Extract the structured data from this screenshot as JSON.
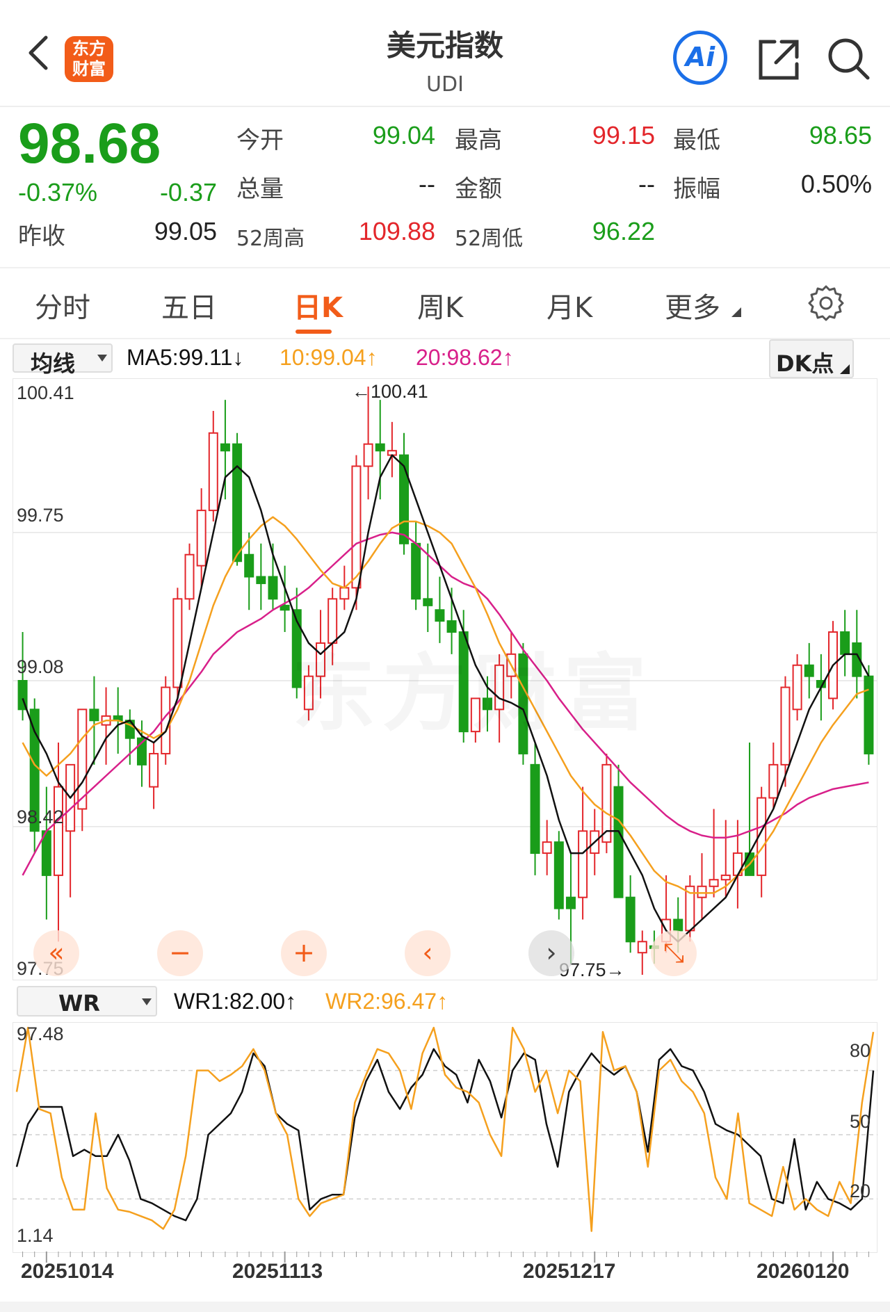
{
  "header": {
    "title": "美元指数",
    "subtitle": "UDI",
    "logo_line1": "东方",
    "logo_line2": "财富",
    "ai_label": "Ai"
  },
  "quote": {
    "price": "98.68",
    "change_pct": "-0.37%",
    "change": "-0.37",
    "prev_close_label": "昨收",
    "prev_close": "99.05",
    "open_label": "今开",
    "open": "99.04",
    "high_label": "最高",
    "high": "99.15",
    "low_label": "最低",
    "low": "98.65",
    "volume_label": "总量",
    "volume": "--",
    "amount_label": "金额",
    "amount": "--",
    "amplitude_label": "振幅",
    "amplitude": "0.50%",
    "w52_high_label": "52周高",
    "w52_high": "109.88",
    "w52_low_label": "52周低",
    "w52_low": "96.22"
  },
  "tabs": [
    {
      "label": "分时"
    },
    {
      "label": "五日"
    },
    {
      "label": "日K"
    },
    {
      "label": "周K"
    },
    {
      "label": "月K"
    },
    {
      "label": "更多"
    }
  ],
  "main_chart": {
    "indicator_select": "均线",
    "ma5": "MA5:99.11↓",
    "ma10": "10:99.04↑",
    "ma20": "20:98.62↑",
    "dk_button": "DK点",
    "y_labels": [
      "100.41",
      "99.75",
      "99.08",
      "98.42",
      "97.75"
    ],
    "max_marker": "←100.41",
    "min_marker": "97.75→",
    "watermark": "东方财富"
  },
  "sub_chart": {
    "indicator_select": "WR",
    "wr1": "WR1:82.00↑",
    "wr2": "WR2:96.47↑",
    "y_max": "97.48",
    "y_min": "1.14",
    "levels": [
      "80",
      "50",
      "20"
    ]
  },
  "dates": [
    "20251014",
    "20251113",
    "20251217",
    "20260120"
  ],
  "colors": {
    "up": "#e3262b",
    "down": "#1a9d1a",
    "ma5": "#111111",
    "ma10": "#f5a01e",
    "ma20": "#d8208a",
    "accent": "#f25c19"
  },
  "chart_data": {
    "type": "candlestick",
    "y_range": [
      97.75,
      100.41
    ],
    "candles": [
      {
        "o": 99.08,
        "h": 99.3,
        "l": 98.9,
        "c": 98.95
      },
      {
        "o": 98.95,
        "h": 99.0,
        "l": 98.3,
        "c": 98.4
      },
      {
        "o": 98.4,
        "h": 98.6,
        "l": 98.0,
        "c": 98.2
      },
      {
        "o": 98.2,
        "h": 98.8,
        "l": 97.9,
        "c": 98.6
      },
      {
        "o": 98.4,
        "h": 98.7,
        "l": 98.1,
        "c": 98.7
      },
      {
        "o": 98.5,
        "h": 98.95,
        "l": 98.4,
        "c": 98.95
      },
      {
        "o": 98.95,
        "h": 99.1,
        "l": 98.7,
        "c": 98.9
      },
      {
        "o": 98.88,
        "h": 99.05,
        "l": 98.7,
        "c": 98.92
      },
      {
        "o": 98.92,
        "h": 99.05,
        "l": 98.75,
        "c": 98.9
      },
      {
        "o": 98.9,
        "h": 98.95,
        "l": 98.7,
        "c": 98.82
      },
      {
        "o": 98.82,
        "h": 98.9,
        "l": 98.6,
        "c": 98.7
      },
      {
        "o": 98.6,
        "h": 98.8,
        "l": 98.5,
        "c": 98.75
      },
      {
        "o": 98.75,
        "h": 99.1,
        "l": 98.7,
        "c": 99.05
      },
      {
        "o": 99.05,
        "h": 99.5,
        "l": 99.0,
        "c": 99.45
      },
      {
        "o": 99.45,
        "h": 99.7,
        "l": 99.4,
        "c": 99.65
      },
      {
        "o": 99.6,
        "h": 99.95,
        "l": 99.5,
        "c": 99.85
      },
      {
        "o": 99.85,
        "h": 100.3,
        "l": 99.8,
        "c": 100.2
      },
      {
        "o": 100.15,
        "h": 100.35,
        "l": 99.9,
        "c": 100.12
      },
      {
        "o": 100.15,
        "h": 100.2,
        "l": 99.6,
        "c": 99.62
      },
      {
        "o": 99.65,
        "h": 99.75,
        "l": 99.4,
        "c": 99.55
      },
      {
        "o": 99.55,
        "h": 99.7,
        "l": 99.4,
        "c": 99.52
      },
      {
        "o": 99.55,
        "h": 99.7,
        "l": 99.4,
        "c": 99.45
      },
      {
        "o": 99.42,
        "h": 99.6,
        "l": 99.3,
        "c": 99.4
      },
      {
        "o": 99.4,
        "h": 99.5,
        "l": 99.0,
        "c": 99.05
      },
      {
        "o": 98.95,
        "h": 99.15,
        "l": 98.9,
        "c": 99.1
      },
      {
        "o": 99.1,
        "h": 99.4,
        "l": 99.0,
        "c": 99.25
      },
      {
        "o": 99.25,
        "h": 99.5,
        "l": 99.15,
        "c": 99.45
      },
      {
        "o": 99.45,
        "h": 99.6,
        "l": 99.4,
        "c": 99.5
      },
      {
        "o": 99.5,
        "h": 100.1,
        "l": 99.4,
        "c": 100.05
      },
      {
        "o": 100.05,
        "h": 100.41,
        "l": 99.9,
        "c": 100.15
      },
      {
        "o": 100.15,
        "h": 100.35,
        "l": 99.9,
        "c": 100.12
      },
      {
        "o": 100.1,
        "h": 100.25,
        "l": 100.0,
        "c": 100.12
      },
      {
        "o": 100.1,
        "h": 100.2,
        "l": 99.65,
        "c": 99.7
      },
      {
        "o": 99.7,
        "h": 99.8,
        "l": 99.4,
        "c": 99.45
      },
      {
        "o": 99.45,
        "h": 99.7,
        "l": 99.3,
        "c": 99.42
      },
      {
        "o": 99.4,
        "h": 99.55,
        "l": 99.25,
        "c": 99.35
      },
      {
        "o": 99.35,
        "h": 99.5,
        "l": 99.2,
        "c": 99.3
      },
      {
        "o": 99.3,
        "h": 99.4,
        "l": 98.8,
        "c": 98.85
      },
      {
        "o": 98.85,
        "h": 99.0,
        "l": 98.8,
        "c": 99.0
      },
      {
        "o": 99.0,
        "h": 99.1,
        "l": 98.85,
        "c": 98.95
      },
      {
        "o": 98.95,
        "h": 99.2,
        "l": 98.8,
        "c": 99.15
      },
      {
        "o": 99.1,
        "h": 99.3,
        "l": 99.0,
        "c": 99.2
      },
      {
        "o": 99.2,
        "h": 99.25,
        "l": 98.7,
        "c": 98.75
      },
      {
        "o": 98.7,
        "h": 98.8,
        "l": 98.2,
        "c": 98.3
      },
      {
        "o": 98.3,
        "h": 98.45,
        "l": 98.2,
        "c": 98.35
      },
      {
        "o": 98.35,
        "h": 98.4,
        "l": 98.0,
        "c": 98.05
      },
      {
        "o": 98.1,
        "h": 98.3,
        "l": 97.8,
        "c": 98.05
      },
      {
        "o": 98.1,
        "h": 98.6,
        "l": 98.0,
        "c": 98.4
      },
      {
        "o": 98.3,
        "h": 98.5,
        "l": 98.2,
        "c": 98.4
      },
      {
        "o": 98.35,
        "h": 98.75,
        "l": 98.3,
        "c": 98.7
      },
      {
        "o": 98.6,
        "h": 98.7,
        "l": 98.1,
        "c": 98.1
      },
      {
        "o": 98.1,
        "h": 98.2,
        "l": 97.85,
        "c": 97.9
      },
      {
        "o": 97.85,
        "h": 97.95,
        "l": 97.75,
        "c": 97.9
      },
      {
        "o": 97.88,
        "h": 97.95,
        "l": 97.8,
        "c": 97.87
      },
      {
        "o": 97.9,
        "h": 98.2,
        "l": 97.85,
        "c": 98.0
      },
      {
        "o": 98.0,
        "h": 98.1,
        "l": 97.85,
        "c": 97.95
      },
      {
        "o": 97.95,
        "h": 98.2,
        "l": 97.9,
        "c": 98.15
      },
      {
        "o": 98.1,
        "h": 98.3,
        "l": 98.0,
        "c": 98.15
      },
      {
        "o": 98.15,
        "h": 98.5,
        "l": 98.1,
        "c": 98.18
      },
      {
        "o": 98.18,
        "h": 98.45,
        "l": 98.1,
        "c": 98.2
      },
      {
        "o": 98.2,
        "h": 98.45,
        "l": 98.05,
        "c": 98.3
      },
      {
        "o": 98.3,
        "h": 98.8,
        "l": 98.2,
        "c": 98.2
      },
      {
        "o": 98.2,
        "h": 98.6,
        "l": 98.1,
        "c": 98.55
      },
      {
        "o": 98.55,
        "h": 98.8,
        "l": 98.5,
        "c": 98.7
      },
      {
        "o": 98.7,
        "h": 99.1,
        "l": 98.6,
        "c": 99.05
      },
      {
        "o": 98.95,
        "h": 99.2,
        "l": 98.9,
        "c": 99.15
      },
      {
        "o": 99.15,
        "h": 99.25,
        "l": 99.0,
        "c": 99.1
      },
      {
        "o": 99.08,
        "h": 99.2,
        "l": 98.9,
        "c": 99.05
      },
      {
        "o": 99.0,
        "h": 99.35,
        "l": 98.95,
        "c": 99.3
      },
      {
        "o": 99.3,
        "h": 99.4,
        "l": 99.1,
        "c": 99.2
      },
      {
        "o": 99.25,
        "h": 99.4,
        "l": 99.0,
        "c": 99.1
      },
      {
        "o": 99.1,
        "h": 99.15,
        "l": 98.7,
        "c": 98.75
      }
    ],
    "ma5": [
      99.0,
      98.85,
      98.75,
      98.62,
      98.55,
      98.62,
      98.72,
      98.82,
      98.88,
      98.9,
      98.83,
      98.8,
      98.85,
      99.0,
      99.25,
      99.5,
      99.75,
      100.0,
      100.05,
      100.0,
      99.85,
      99.65,
      99.5,
      99.35,
      99.25,
      99.2,
      99.25,
      99.3,
      99.45,
      99.75,
      100.0,
      100.1,
      100.05,
      99.9,
      99.75,
      99.6,
      99.45,
      99.3,
      99.15,
      99.05,
      99.0,
      98.98,
      98.95,
      98.8,
      98.65,
      98.45,
      98.3,
      98.3,
      98.35,
      98.4,
      98.4,
      98.3,
      98.2,
      98.05,
      97.95,
      97.9,
      97.95,
      98.0,
      98.05,
      98.1,
      98.2,
      98.3,
      98.4,
      98.5,
      98.65,
      98.8,
      98.95,
      99.05,
      99.15,
      99.2,
      99.2,
      99.1
    ],
    "ma10": [
      98.8,
      98.7,
      98.65,
      98.7,
      98.75,
      98.82,
      98.88,
      98.9,
      98.9,
      98.88,
      98.85,
      98.82,
      98.85,
      98.95,
      99.08,
      99.25,
      99.42,
      99.55,
      99.65,
      99.72,
      99.78,
      99.82,
      99.78,
      99.72,
      99.65,
      99.58,
      99.52,
      99.5,
      99.55,
      99.62,
      99.7,
      99.77,
      99.8,
      99.8,
      99.78,
      99.75,
      99.7,
      99.6,
      99.5,
      99.38,
      99.25,
      99.15,
      99.05,
      98.95,
      98.85,
      98.75,
      98.65,
      98.58,
      98.52,
      98.48,
      98.45,
      98.38,
      98.3,
      98.22,
      98.17,
      98.15,
      98.12,
      98.12,
      98.12,
      98.15,
      98.2,
      98.25,
      98.32,
      98.4,
      98.5,
      98.6,
      98.7,
      98.8,
      98.88,
      98.95,
      99.02,
      99.04
    ],
    "ma20": [
      98.2,
      98.3,
      98.4,
      98.45,
      98.5,
      98.55,
      98.6,
      98.65,
      98.7,
      98.75,
      98.8,
      98.85,
      98.92,
      98.98,
      99.05,
      99.12,
      99.2,
      99.25,
      99.3,
      99.33,
      99.36,
      99.4,
      99.43,
      99.46,
      99.5,
      99.55,
      99.6,
      99.65,
      99.7,
      99.72,
      99.74,
      99.75,
      99.74,
      99.7,
      99.65,
      99.6,
      99.55,
      99.52,
      99.5,
      99.45,
      99.38,
      99.3,
      99.22,
      99.15,
      99.08,
      99.0,
      98.93,
      98.86,
      98.8,
      98.74,
      98.68,
      98.62,
      98.57,
      98.52,
      98.47,
      98.43,
      98.4,
      98.38,
      98.37,
      98.37,
      98.38,
      98.4,
      98.42,
      98.45,
      98.48,
      98.52,
      98.55,
      98.57,
      98.59,
      98.6,
      98.61,
      98.62
    ],
    "wr_range": [
      0,
      100
    ],
    "wr1": [
      35,
      55,
      63,
      63,
      63,
      40,
      43,
      40,
      40,
      50,
      38,
      20,
      18,
      15,
      12,
      10,
      20,
      50,
      55,
      60,
      70,
      88,
      82,
      60,
      55,
      52,
      15,
      20,
      22,
      22,
      58,
      75,
      85,
      70,
      62,
      72,
      78,
      90,
      82,
      78,
      65,
      85,
      75,
      58,
      80,
      88,
      85,
      55,
      35,
      70,
      80,
      88,
      82,
      78,
      82,
      70,
      42,
      85,
      90,
      82,
      80,
      70,
      55,
      52,
      50,
      45,
      40,
      20,
      18,
      48,
      15,
      28,
      20,
      18,
      15,
      20,
      80
    ],
    "wr2": [
      70,
      100,
      62,
      60,
      30,
      15,
      15,
      60,
      25,
      15,
      14,
      12,
      10,
      6,
      15,
      40,
      80,
      80,
      75,
      78,
      82,
      90,
      80,
      60,
      50,
      20,
      12,
      18,
      20,
      22,
      65,
      78,
      90,
      88,
      80,
      62,
      88,
      100,
      78,
      72,
      70,
      65,
      50,
      40,
      100,
      90,
      70,
      80,
      60,
      80,
      75,
      5,
      98,
      80,
      82,
      70,
      35,
      80,
      85,
      75,
      70,
      60,
      30,
      20,
      60,
      18,
      15,
      12,
      35,
      15,
      20,
      15,
      12,
      28,
      18,
      65,
      98
    ]
  }
}
